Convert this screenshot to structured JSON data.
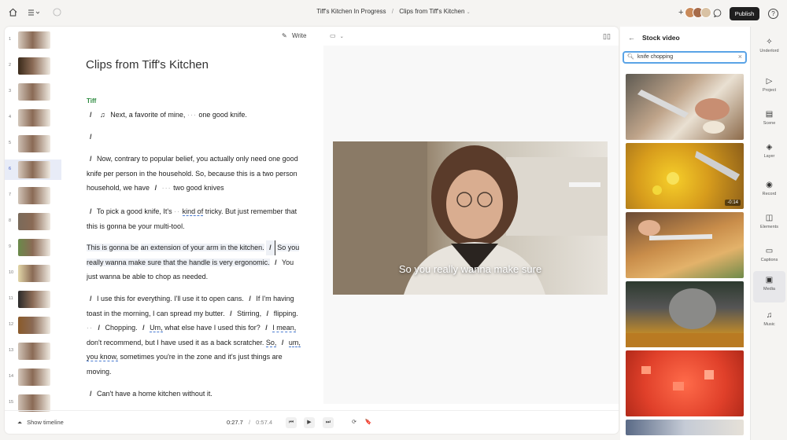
{
  "topbar": {
    "breadcrumb_project": "Tiff's Kitchen In Progress",
    "breadcrumb_separator": "/",
    "breadcrumb_composition": "Clips from Tiff's Kitchen",
    "publish_label": "Publish",
    "help_label": "?"
  },
  "toolbar": {
    "write_label": "Write"
  },
  "script": {
    "title": "Clips from Tiff's Kitchen",
    "speaker": "Tiff",
    "paragraphs": {
      "p1": "Next, a favorite of mine,",
      "p1b": "one good knife.",
      "p3": "Now, contrary to popular belief, you actually only need one good knife per person in the household. So, because this is a two person household, we have",
      "p3b": "two good knives",
      "p4a": "To pick a good knife, It's",
      "p4b": "kind of",
      "p4c": "tricky. But just remember that this is gonna be your multi-tool.",
      "p5a": "This is gonna be",
      "p5b": "an extension of your arm in the kitchen.",
      "p5c": "So you really wanna make sure that the handle is very ergonomic.",
      "p5d": "You just wanna be able to chop as needed.",
      "p6a": "I use this for everything.",
      "p6b": "I'll use it to open cans.",
      "p6c": "If I'm having toast in the morning, I can spread my butter.",
      "p6d": "Stirring,",
      "p6e": "flipping.",
      "p6f": "Chopping.",
      "p6g": "Um,",
      "p6h": "what else have I used this for?",
      "p6i": "I mean,",
      "p6j": "don't recommend, but I have used it as a back scratcher.",
      "p6k": "So,",
      "p6l": "um, you know,",
      "p6m": "sometimes you're in the zone and it's just things are moving.",
      "p7": "Can't have a home kitchen without it."
    }
  },
  "preview": {
    "caption": "So you really wanna make sure"
  },
  "footer": {
    "show_timeline_label": "Show timeline",
    "current_time": "0:27.7",
    "time_separator": "/",
    "total_time": "0:57.4"
  },
  "thumbs": {
    "numbers": [
      "1",
      "2",
      "3",
      "4",
      "5",
      "6",
      "7",
      "8",
      "9",
      "10",
      "11",
      "12",
      "13",
      "14",
      "15"
    ],
    "active_index": 6
  },
  "stock_panel": {
    "title": "Stock video",
    "search_value": "knife chopping",
    "results": [
      {
        "name": "knife-chopping-onion"
      },
      {
        "name": "yellow-pepper-chop",
        "duration": "-0:14"
      },
      {
        "name": "cutting-board-knife"
      },
      {
        "name": "blurry-blade"
      },
      {
        "name": "diced-tomatoes"
      },
      {
        "name": "woman-kitchen"
      }
    ]
  },
  "rail": {
    "items": [
      {
        "label": "Underlord",
        "icon": "sparkle-icon"
      },
      {
        "label": "Project",
        "icon": "folder-play-icon"
      },
      {
        "label": "Scene",
        "icon": "scene-icon"
      },
      {
        "label": "Layer",
        "icon": "layers-icon"
      },
      {
        "label": "Record",
        "icon": "record-icon"
      },
      {
        "label": "Elements",
        "icon": "elements-icon"
      },
      {
        "label": "Captions",
        "icon": "captions-icon"
      },
      {
        "label": "Media",
        "icon": "media-icon"
      },
      {
        "label": "Music",
        "icon": "music-icon"
      }
    ],
    "active": "Media"
  },
  "colors": {
    "speaker": "#2b8a3e",
    "search_border": "#5aa3e6",
    "publish_bg": "#1f1f1f",
    "active_thumb": "#e8ecf7"
  }
}
